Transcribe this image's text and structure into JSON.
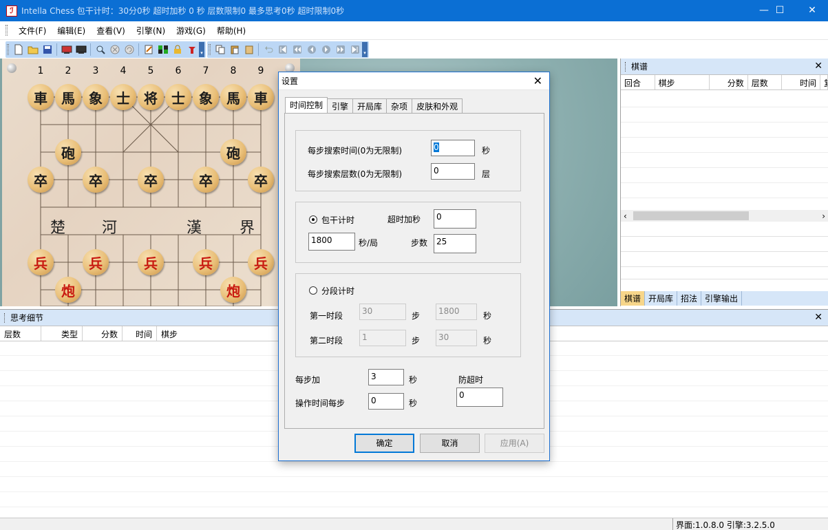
{
  "window": {
    "title": "Intella Chess 包干计时：30分0秒 超时加秒 0 秒 层数限制0 最多思考0秒 超时限制0秒",
    "icon_glyph": "ℐ",
    "minimize": "—",
    "maximize": "☐",
    "close": "✕"
  },
  "menu": [
    "文件(F)",
    "编辑(E)",
    "查看(V)",
    "引擎(N)",
    "游戏(G)",
    "帮助(H)"
  ],
  "toolbar": {
    "group1": [
      "new-file-icon",
      "open-folder-icon",
      "save-icon",
      "red-side-icon",
      "black-side-icon",
      "search-icon",
      "stop-icon",
      "refresh-icon",
      "edit-icon",
      "flip-board-icon",
      "lock-icon",
      "hint-icon"
    ],
    "group2": [
      "copy-icon",
      "paste-icon",
      "clipboard-icon",
      "undo-icon",
      "first-icon",
      "prev-prev-icon",
      "prev-icon",
      "next-icon",
      "next-next-icon",
      "last-icon"
    ],
    "more": "▾"
  },
  "board": {
    "file_numbers": [
      "1",
      "2",
      "3",
      "4",
      "5",
      "6",
      "7",
      "8",
      "9"
    ],
    "river": [
      "楚",
      "河",
      "漢",
      "界"
    ],
    "pieces": {
      "back_row": [
        "車",
        "馬",
        "象",
        "士",
        "将",
        "士",
        "象",
        "馬",
        "車"
      ],
      "cannons_black": [
        "砲",
        "砲"
      ],
      "soldiers_black": [
        "卒",
        "卒",
        "卒",
        "卒",
        "卒"
      ],
      "soldiers_red": [
        "兵",
        "兵",
        "兵",
        "兵",
        "兵"
      ],
      "cannons_red": [
        "炮",
        "炮"
      ]
    }
  },
  "record_panel": {
    "title": "棋谱",
    "close": "✕",
    "columns": [
      "回合",
      "棋步",
      "分数",
      "层数",
      "时间",
      "复"
    ],
    "scroll_left": "‹",
    "scroll_right": "›",
    "tabs": [
      "棋谱",
      "开局库",
      "招法",
      "引擎输出"
    ]
  },
  "think_panel": {
    "title": "思考细节",
    "close": "✕",
    "columns": [
      "层数",
      "类型",
      "分数",
      "时间",
      "棋步"
    ]
  },
  "status": {
    "text": "界面:1.0.8.0 引擎:3.2.5.0"
  },
  "dialog": {
    "title": "设置",
    "close": "✕",
    "tabs": [
      "时间控制",
      "引擎",
      "开局库",
      "杂项",
      "皮肤和外观"
    ],
    "search_time_label": "每步搜索时间(0为无限制)",
    "search_time_value": "0",
    "search_time_unit": "秒",
    "search_depth_label": "每步搜索层数(0为无限制)",
    "search_depth_value": "0",
    "search_depth_unit": "层",
    "package_label": "包干计时",
    "overtime_label": "超时加秒",
    "overtime_value": "0",
    "game_seconds_value": "1800",
    "game_seconds_unit": "秒/局",
    "moves_label": "步数",
    "moves_value": "25",
    "segment_label": "分段计时",
    "period1_label": "第一时段",
    "period1_moves": "30",
    "period1_seconds": "1800",
    "period2_label": "第二时段",
    "period2_moves": "1",
    "period2_seconds": "30",
    "step_unit": "步",
    "sec_unit": "秒",
    "per_move_add_label": "每步加",
    "per_move_add_value": "3",
    "op_time_label": "操作时间每步",
    "op_time_value": "0",
    "anti_timeout_label": "防超时",
    "anti_timeout_value": "0",
    "ok": "确定",
    "cancel": "取消",
    "apply": "应用(A)"
  }
}
